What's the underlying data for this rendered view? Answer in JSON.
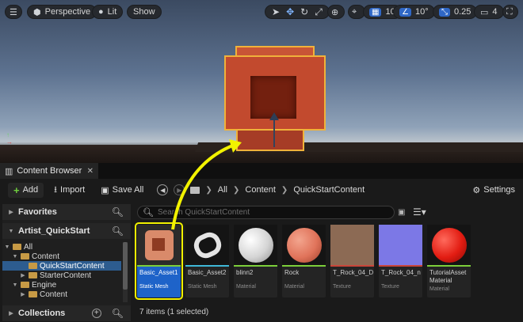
{
  "viewport_toolbar": {
    "perspective": "Perspective",
    "lit": "Lit",
    "show": "Show",
    "grid_snap": "10",
    "rotation_snap": "10°",
    "scale_snap": "0.25",
    "camera_speed": "4"
  },
  "content_browser": {
    "tab_label": "Content Browser",
    "add_label": "Add",
    "import_label": "Import",
    "save_all_label": "Save All",
    "breadcrumb": [
      "All",
      "Content",
      "QuickStartContent"
    ],
    "settings_label": "Settings",
    "favorites_label": "Favorites",
    "project_label": "Artist_QuickStart",
    "collections_label": "Collections",
    "tree": [
      {
        "label": "All",
        "depth": 0,
        "open": true
      },
      {
        "label": "Content",
        "depth": 1,
        "open": true
      },
      {
        "label": "QuickStartContent",
        "depth": 2,
        "selected": true
      },
      {
        "label": "StarterContent",
        "depth": 2,
        "open": false
      },
      {
        "label": "Engine",
        "depth": 1,
        "open": true
      },
      {
        "label": "Content",
        "depth": 2,
        "open": false
      }
    ],
    "search_placeholder": "Search QuickStartContent",
    "assets": [
      {
        "name": "Basic_Asset1",
        "type": "Static Mesh",
        "selected": true,
        "bar": "#7ccf3a"
      },
      {
        "name": "Basic_Asset2",
        "type": "Static Mesh",
        "bar": "#3fb8d8"
      },
      {
        "name": "blinn2",
        "type": "Material",
        "bar": "#7ccf3a"
      },
      {
        "name": "Rock",
        "type": "Material",
        "bar": "#7ccf3a"
      },
      {
        "name": "T_Rock_04_D",
        "type": "Texture",
        "bar": "#c9453a"
      },
      {
        "name": "T_Rock_04_n",
        "type": "Texture",
        "bar": "#c9453a"
      },
      {
        "name": "TutorialAsset Material",
        "type": "Material",
        "bar": "#7ccf3a"
      }
    ],
    "status": "7 items (1 selected)"
  },
  "colors": {
    "selection_blue": "#1e63c9",
    "highlight_yellow": "#f2f200",
    "asset_red": "#c24a2e"
  }
}
